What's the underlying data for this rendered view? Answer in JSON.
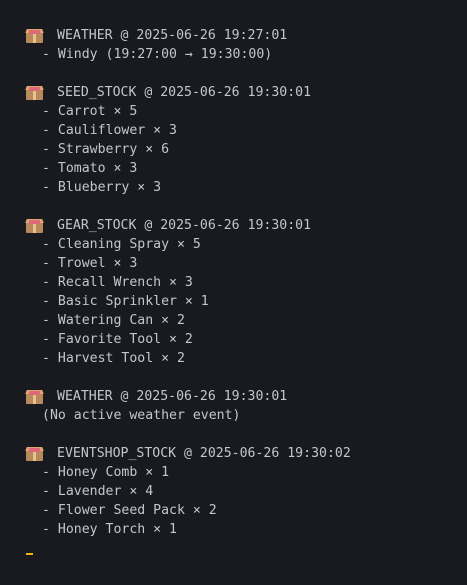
{
  "blocks": [
    {
      "icon": "package-icon",
      "header": "WEATHER @ 2025-06-26 19:27:01",
      "items": [
        "- Windy (19:27:00 → 19:30:00)"
      ]
    },
    {
      "icon": "package-icon",
      "header": "SEED_STOCK @ 2025-06-26 19:30:01",
      "items": [
        "- Carrot × 5",
        "- Cauliflower × 3",
        "- Strawberry × 6",
        "- Tomato × 3",
        "- Blueberry × 3"
      ]
    },
    {
      "icon": "package-icon",
      "header": "GEAR_STOCK @ 2025-06-26 19:30:01",
      "items": [
        "- Cleaning Spray × 5",
        "- Trowel × 3",
        "- Recall Wrench × 3",
        "- Basic Sprinkler × 1",
        "- Watering Can × 2",
        "- Favorite Tool × 2",
        "- Harvest Tool × 2"
      ]
    },
    {
      "icon": "package-icon",
      "header": "WEATHER @ 2025-06-26 19:30:01",
      "items": [
        "(No active weather event)"
      ]
    },
    {
      "icon": "package-icon",
      "header": "EVENTSHOP_STOCK @ 2025-06-26 19:30:02",
      "items": [
        "- Honey Comb × 1",
        "- Lavender × 4",
        "- Flower Seed Pack × 2",
        "- Honey Torch × 1"
      ]
    }
  ],
  "colors": {
    "background": "#181a1f",
    "text": "#c4c6cc",
    "cursor": "#f2b705"
  }
}
